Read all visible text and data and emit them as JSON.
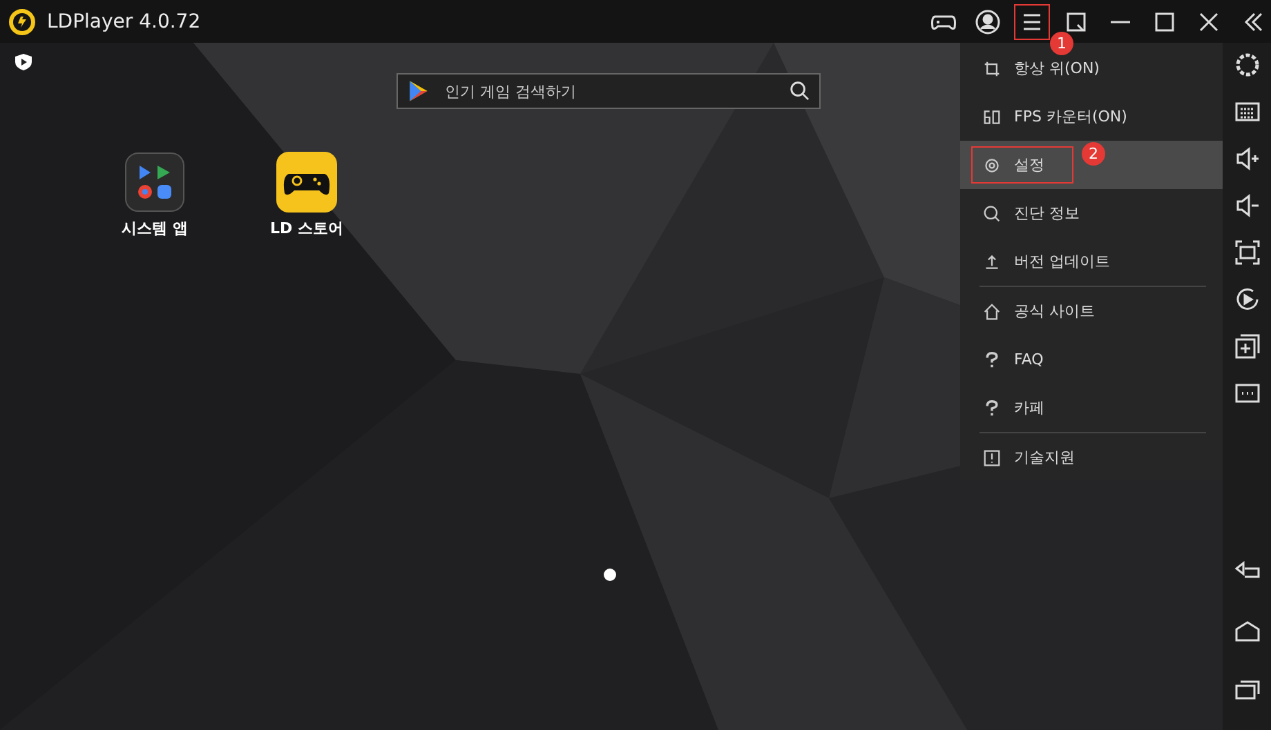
{
  "window": {
    "title": "LDPlayer 4.0.72"
  },
  "toolbar": [
    {
      "kind": "gamepad"
    },
    {
      "kind": "account"
    },
    {
      "kind": "menu",
      "annotation": "1"
    },
    {
      "kind": "resize"
    },
    {
      "kind": "minimize"
    },
    {
      "kind": "maximize"
    },
    {
      "kind": "close"
    },
    {
      "kind": "collapse"
    }
  ],
  "search": {
    "placeholder": "인기 게임 검색하기"
  },
  "apps": [
    {
      "kind": "system",
      "label": "시스템 앱"
    },
    {
      "kind": "store",
      "label": "LD 스토어"
    }
  ],
  "menu": {
    "groups": [
      [
        {
          "kind": "pin",
          "label": "항상 위(ON)",
          "selected": false
        },
        {
          "kind": "fps",
          "label": "FPS 카운터(ON)",
          "selected": false
        },
        {
          "kind": "gear",
          "label": "설정",
          "selected": true,
          "annotation": "2"
        },
        {
          "kind": "search",
          "label": "진단 정보",
          "selected": false
        },
        {
          "kind": "upload",
          "label": "버전 업데이트",
          "selected": false
        }
      ],
      [
        {
          "kind": "home",
          "label": "공식 사이트",
          "selected": false
        },
        {
          "kind": "question",
          "label": "FAQ",
          "selected": false
        },
        {
          "kind": "question",
          "label": "카페",
          "selected": false
        }
      ],
      [
        {
          "kind": "info",
          "label": "기술지원",
          "selected": false
        }
      ]
    ]
  },
  "sidebar": {
    "top": [
      {
        "kind": "settings"
      },
      {
        "kind": "keyboard"
      },
      {
        "kind": "volume-up"
      },
      {
        "kind": "volume-down"
      },
      {
        "kind": "screenshot"
      },
      {
        "kind": "record"
      },
      {
        "kind": "add"
      },
      {
        "kind": "more"
      }
    ],
    "bottom": [
      {
        "kind": "back"
      },
      {
        "kind": "home"
      },
      {
        "kind": "recent"
      }
    ]
  }
}
